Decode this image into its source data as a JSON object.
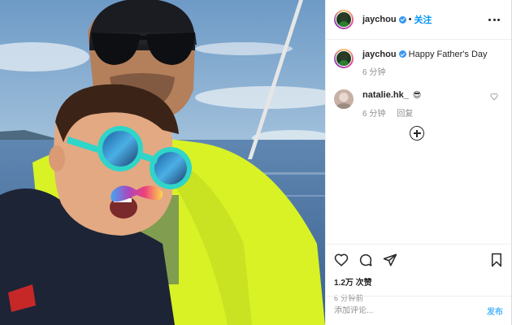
{
  "post": {
    "author": {
      "username": "jaychou",
      "verified": true,
      "follow_label": "关注",
      "separator": "•"
    },
    "caption": {
      "text": "Happy Father's Day",
      "time_ago": "6 分钟"
    },
    "comments": [
      {
        "username": "natalie.hk_",
        "text": "😎",
        "time_ago": "6 分钟",
        "reply_label": "回复"
      }
    ],
    "stats": {
      "likes": "1.2万 次赞",
      "posted": "6 分钟前"
    },
    "composer": {
      "placeholder": "添加评论...",
      "submit_label": "发布"
    }
  },
  "icons": {
    "more": "more-horizontal-icon",
    "like": "heart-icon",
    "comment": "comment-bubble-icon",
    "share": "paper-plane-icon",
    "save": "bookmark-icon",
    "load_more": "plus-circle-icon",
    "comment_like": "small-heart-icon",
    "emoji": "emoji-icon"
  },
  "colors": {
    "link_blue": "#0095f6",
    "verified_blue": "#3897f0",
    "muted_text": "#8e8e8e",
    "primary_text": "#262626",
    "border": "#efefef"
  }
}
